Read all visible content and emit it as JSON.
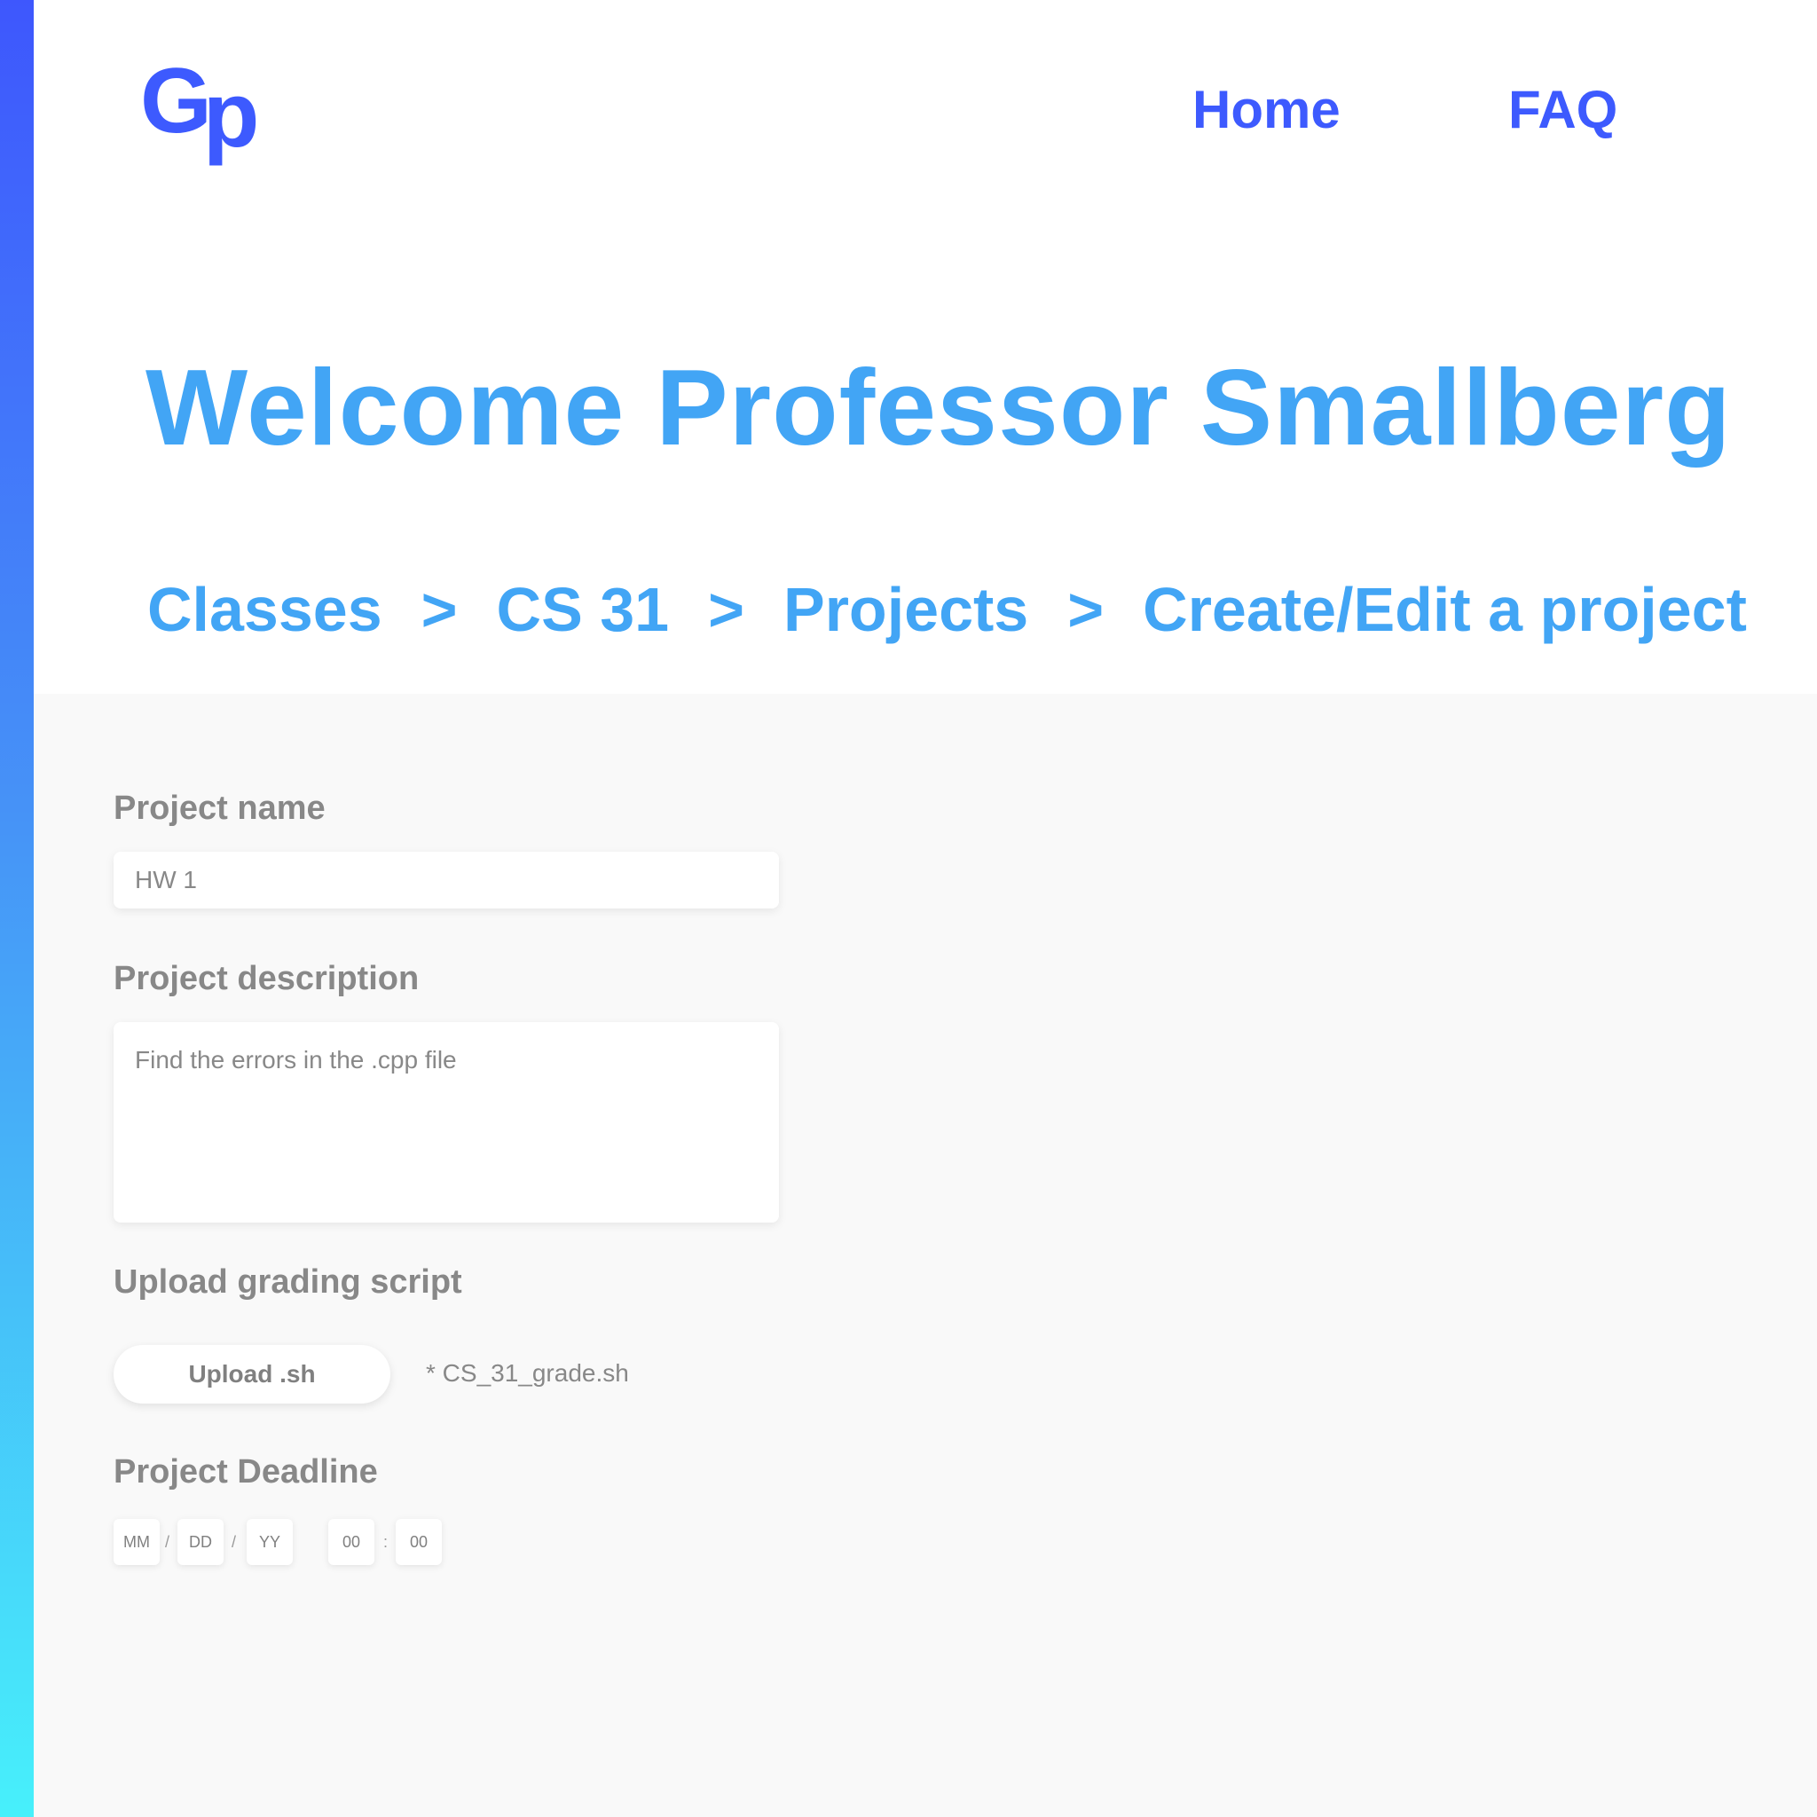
{
  "logo": {
    "g": "G",
    "p": "p"
  },
  "nav": {
    "home": "Home",
    "faq": "FAQ"
  },
  "title": "Welcome Professor Smallberg",
  "breadcrumb": {
    "items": [
      "Classes",
      "CS 31",
      "Projects",
      "Create/Edit a project"
    ],
    "separator": ">"
  },
  "form": {
    "project_name": {
      "label": "Project name",
      "value": "HW 1"
    },
    "project_description": {
      "label": "Project description",
      "value": "Find the errors in the .cpp file"
    },
    "upload": {
      "label": "Upload grading script",
      "button": "Upload .sh",
      "file": "* CS_31_grade.sh"
    },
    "deadline": {
      "label": "Project Deadline",
      "month": "MM",
      "day": "DD",
      "year": "YY",
      "hour": "00",
      "minute": "00",
      "date_separator": "/",
      "time_separator": ":"
    }
  },
  "colors": {
    "brand": "#3d5afe",
    "title": "#42a5f5",
    "label": "#888888",
    "content_bg": "#f9f9f9",
    "sidebar_gradient": [
      "#3e57fd",
      "#4693f7",
      "#47f0fb"
    ]
  }
}
